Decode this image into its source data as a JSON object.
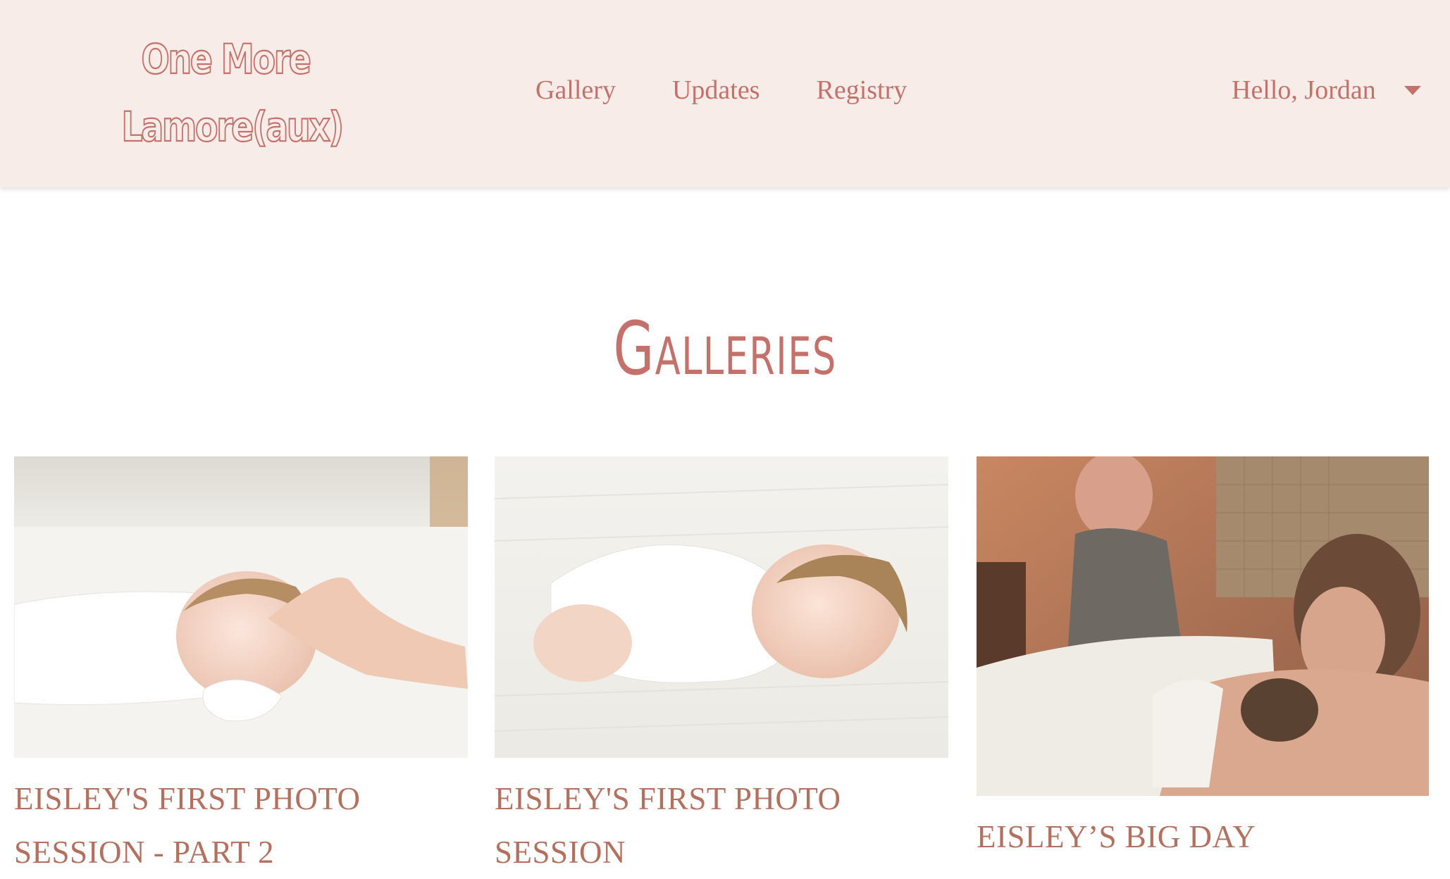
{
  "header": {
    "logo_line1": "One More",
    "logo_line2": "Lamore(aux)",
    "nav": [
      {
        "label": "Gallery"
      },
      {
        "label": "Updates"
      },
      {
        "label": "Registry"
      }
    ],
    "user_greeting": "Hello, Jordan"
  },
  "main": {
    "title": "Galleries",
    "galleries": [
      {
        "caption": "Eisley's First Photo Session - Part 2"
      },
      {
        "caption": "Eisley's First Photo Session"
      },
      {
        "caption": "Eisley’s Big Day"
      }
    ]
  },
  "colors": {
    "header_bg": "#f7ece8",
    "accent": "#c4716b",
    "caption": "#b4705f"
  }
}
